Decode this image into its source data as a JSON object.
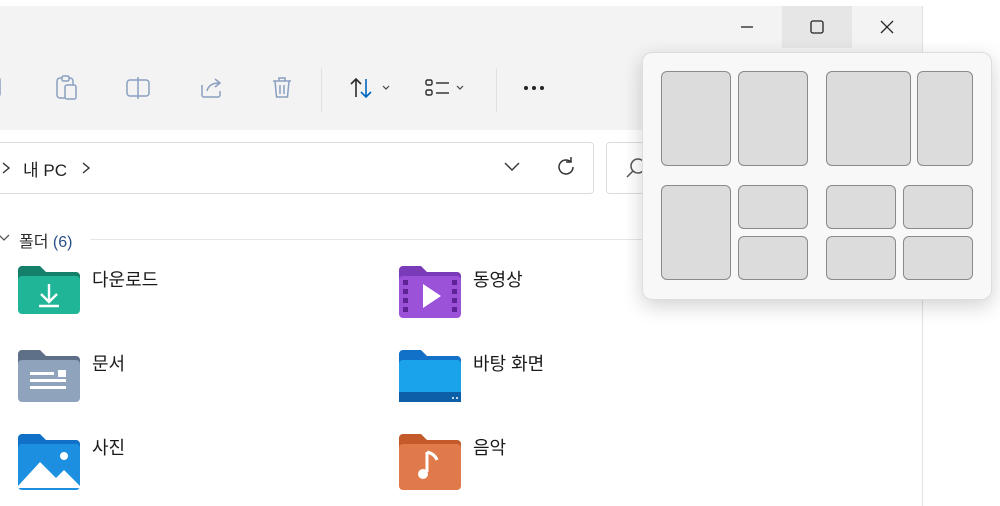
{
  "window_controls": {
    "minimize_icon": "minimize-icon",
    "maximize_icon": "maximize-icon",
    "close_icon": "close-icon"
  },
  "toolbar": {
    "icons": [
      "copy-icon",
      "paste-icon",
      "rename-icon",
      "share-icon",
      "delete-icon",
      "sort-icon",
      "view-icon",
      "more-icon"
    ]
  },
  "address": {
    "crumb": "내 PC",
    "separator": ">"
  },
  "section": {
    "title": "폴더",
    "count": "(6)"
  },
  "folders": [
    {
      "name": "다운로드",
      "icon": "downloads-folder-icon"
    },
    {
      "name": "동영상",
      "icon": "videos-folder-icon"
    },
    {
      "name": "문서",
      "icon": "documents-folder-icon"
    },
    {
      "name": "바탕 화면",
      "icon": "desktop-folder-icon"
    },
    {
      "name": "사진",
      "icon": "pictures-folder-icon"
    },
    {
      "name": "음악",
      "icon": "music-folder-icon"
    }
  ],
  "snap_layouts": {
    "layouts": [
      "two-equal-columns",
      "wide-left-narrow-right",
      "left-half-right-stacked",
      "four-quadrants"
    ]
  },
  "colors": {
    "titlebar": "#f3f3f3",
    "accent": "#0067c0",
    "section_count": "#2b4f8a",
    "snap_zone": "#dcdcdc"
  }
}
